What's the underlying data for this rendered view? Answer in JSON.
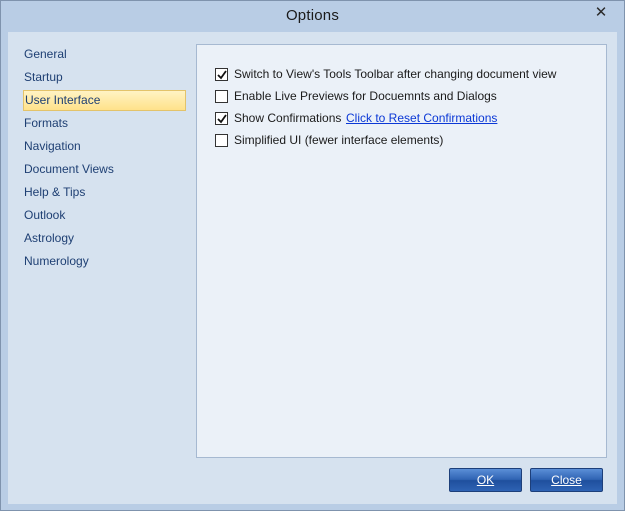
{
  "window": {
    "title": "Options",
    "close_glyph": "✕"
  },
  "nav": {
    "items": [
      {
        "label": "General",
        "selected": false
      },
      {
        "label": "Startup",
        "selected": false
      },
      {
        "label": "User Interface",
        "selected": true
      },
      {
        "label": "Formats",
        "selected": false
      },
      {
        "label": "Navigation",
        "selected": false
      },
      {
        "label": "Document Views",
        "selected": false
      },
      {
        "label": "Help & Tips",
        "selected": false
      },
      {
        "label": "Outlook",
        "selected": false
      },
      {
        "label": "Astrology",
        "selected": false
      },
      {
        "label": "Numerology",
        "selected": false
      }
    ]
  },
  "options": [
    {
      "label": "Switch to View's Tools Toolbar after changing document view",
      "checked": true
    },
    {
      "label": "Enable Live Previews for Docuemnts and Dialogs",
      "checked": false
    },
    {
      "label": "Show Confirmations",
      "checked": true,
      "link": "Click to Reset Confirmations"
    },
    {
      "label": "Simplified UI (fewer interface elements)",
      "checked": false
    }
  ],
  "buttons": {
    "ok": "OK",
    "close": "Close"
  },
  "colors": {
    "frame": "#b9cde5",
    "client": "#d6e2ef",
    "panel": "#ebf1f8",
    "nav_text": "#1e3f73",
    "link": "#0b38d6",
    "button": "#2f63b3"
  }
}
